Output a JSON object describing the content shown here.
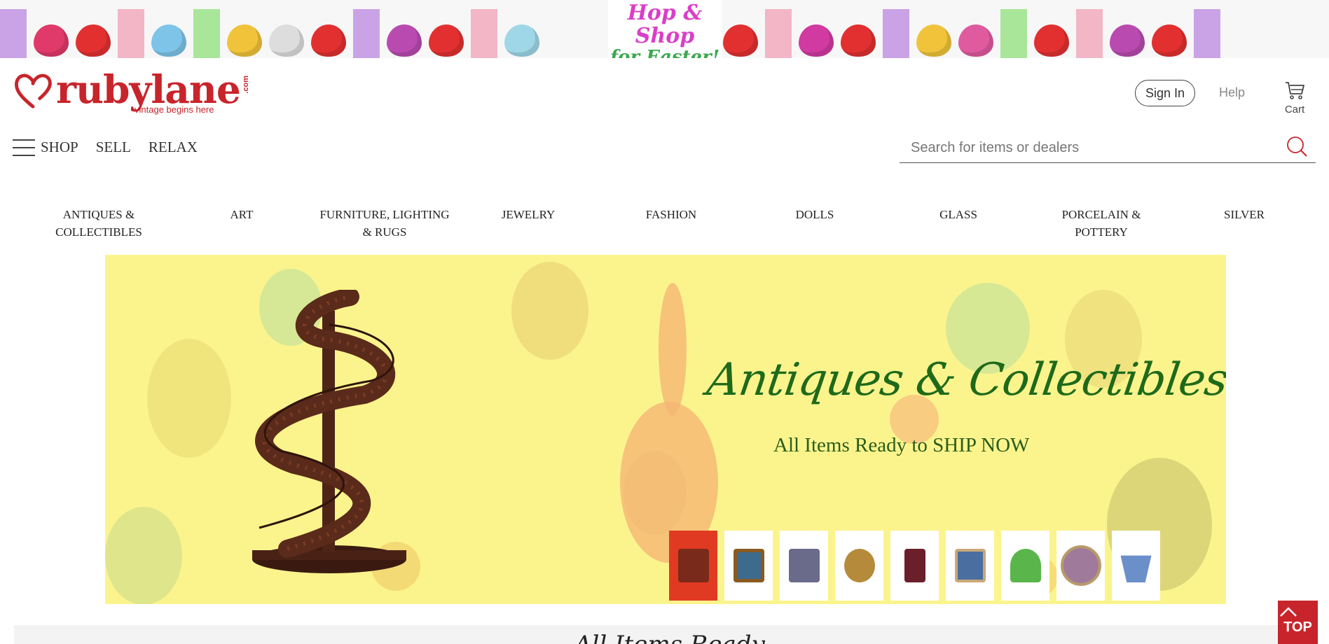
{
  "banner": {
    "line1": "Hop & Shop",
    "line2": "for Easter!"
  },
  "logo": {
    "word": "rubylane",
    "com": ".com",
    "tagline": "vintage begins here"
  },
  "header": {
    "signin_label": "Sign In",
    "help_label": "Help",
    "cart_label": "Cart"
  },
  "topnav": {
    "items": [
      "SHOP",
      "SELL",
      "RELAX"
    ]
  },
  "search": {
    "placeholder": "Search for items or dealers"
  },
  "categories": [
    "ANTIQUES & COLLECTIBLES",
    "ART",
    "FURNITURE, LIGHTING & RUGS",
    "JEWELRY",
    "FASHION",
    "DOLLS",
    "GLASS",
    "PORCELAIN & POTTERY",
    "SILVER"
  ],
  "hero": {
    "title": "Antiques & Collectibles",
    "subtitle": "All Items Ready to SHIP NOW",
    "thumbnails": [
      {
        "icon": "spiral-stair-thumb",
        "color": "#7a2a1a"
      },
      {
        "icon": "framed-painting-thumb",
        "color": "#3c6b8e"
      },
      {
        "icon": "rug-thumb",
        "color": "#6a6a8a"
      },
      {
        "icon": "pendant-thumb",
        "color": "#b58a3a"
      },
      {
        "icon": "cabinet-thumb",
        "color": "#6b1f2a"
      },
      {
        "icon": "doll-thumb",
        "color": "#4a6ea0"
      },
      {
        "icon": "glass-lamp-thumb",
        "color": "#5ab54a"
      },
      {
        "icon": "painted-plate-thumb",
        "color": "#a07a9a"
      },
      {
        "icon": "silver-basket-thumb",
        "color": "#6b8fc9"
      }
    ]
  },
  "bottom": {
    "partial_text": "All Items Ready"
  },
  "top_button": {
    "label": "TOP"
  },
  "colors": {
    "brand": "#c8242b",
    "hero_bg": "#fbf48d",
    "hero_title": "#1e6a1a"
  }
}
